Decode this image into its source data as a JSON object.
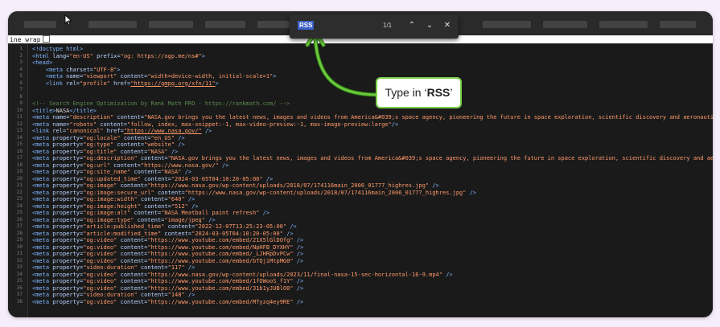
{
  "options": {
    "line_wrap_label": "ine wrap"
  },
  "find": {
    "query": "RSS",
    "count": "1/1",
    "prev_icon": "chevron-up-icon",
    "next_icon": "chevron-down-icon",
    "close_icon": "close-icon"
  },
  "callout": {
    "prefix": "Type in ",
    "quote_open": "‘",
    "term": "RSS",
    "quote_close": "’"
  },
  "colors": {
    "tag": "#7fb7ff",
    "value": "#ff9a6a",
    "comment": "#5e8a4f",
    "callout_border": "#7bd14a"
  },
  "lines": [
    {
      "n": "1",
      "parts": [
        [
          "tag",
          "<!doctype html>"
        ]
      ]
    },
    {
      "n": "2",
      "parts": [
        [
          "tag",
          "<html "
        ],
        [
          "attr",
          "lang="
        ],
        [
          "val",
          "\"en-US\""
        ],
        [
          "attr",
          " prefix="
        ],
        [
          "val",
          "\"og: https://ogp.me/ns#\""
        ],
        [
          "tag",
          ">"
        ]
      ]
    },
    {
      "n": "3",
      "parts": [
        [
          "tag",
          "<head>"
        ]
      ]
    },
    {
      "n": "4",
      "parts": [
        [
          "plain",
          "    "
        ],
        [
          "tag",
          "<meta "
        ],
        [
          "attr",
          "charset="
        ],
        [
          "val",
          "\"UTF-8\""
        ],
        [
          "tag",
          ">"
        ]
      ]
    },
    {
      "n": "5",
      "parts": [
        [
          "plain",
          "    "
        ],
        [
          "tag",
          "<meta "
        ],
        [
          "attr",
          "name="
        ],
        [
          "val",
          "\"viewport\""
        ],
        [
          "attr",
          " content="
        ],
        [
          "val",
          "\"width=device-width, initial-scale=1\""
        ],
        [
          "tag",
          ">"
        ]
      ]
    },
    {
      "n": "6",
      "parts": [
        [
          "plain",
          "    "
        ],
        [
          "tag",
          "<link "
        ],
        [
          "attr",
          "rel="
        ],
        [
          "val",
          "\"profile\""
        ],
        [
          "attr",
          " href="
        ],
        [
          "link",
          "\"https://gmpg.org/xfn/11\""
        ],
        [
          "tag",
          ">"
        ]
      ]
    },
    {
      "n": "7",
      "parts": []
    },
    {
      "n": "8",
      "parts": []
    },
    {
      "n": "9",
      "parts": [
        [
          "comment",
          "<!-- Search Engine Optimization by Rank Math PRO - https://rankmath.com/ -->"
        ]
      ]
    },
    {
      "n": "10",
      "parts": [
        [
          "tag",
          "<title>"
        ],
        [
          "plain",
          "NASA"
        ],
        [
          "tag",
          "</title>"
        ]
      ]
    },
    {
      "n": "11",
      "parts": [
        [
          "tag",
          "<meta "
        ],
        [
          "attr",
          "name="
        ],
        [
          "val",
          "\"description\""
        ],
        [
          "attr",
          " content="
        ],
        [
          "val",
          "\"NASA.gov brings you the latest news, images and videos from America&#039;s space agency, pioneering the future in space exploration, scientific discovery and aeronautics research.\""
        ]
      ]
    },
    {
      "n": "12",
      "parts": [
        [
          "tag",
          "<meta "
        ],
        [
          "attr",
          "name="
        ],
        [
          "val",
          "\"robots\""
        ],
        [
          "attr",
          " content="
        ],
        [
          "val",
          "\"follow, index, max-snippet:-1, max-video-preview:-1, max-image-preview:large\""
        ],
        [
          "tag",
          "/>"
        ]
      ]
    },
    {
      "n": "13",
      "parts": [
        [
          "tag",
          "<link "
        ],
        [
          "attr",
          "rel="
        ],
        [
          "val",
          "\"canonical\""
        ],
        [
          "attr",
          " href="
        ],
        [
          "link",
          "\"https://www.nasa.gov/\""
        ],
        [
          "tag",
          " />"
        ]
      ]
    },
    {
      "n": "14",
      "parts": [
        [
          "tag",
          "<meta "
        ],
        [
          "attr",
          "property="
        ],
        [
          "val",
          "\"og:locale\""
        ],
        [
          "attr",
          " content="
        ],
        [
          "val",
          "\"en_US\""
        ],
        [
          "tag",
          " />"
        ]
      ]
    },
    {
      "n": "15",
      "parts": [
        [
          "tag",
          "<meta "
        ],
        [
          "attr",
          "property="
        ],
        [
          "val",
          "\"og:type\""
        ],
        [
          "attr",
          " content="
        ],
        [
          "val",
          "\"website\""
        ],
        [
          "tag",
          " />"
        ]
      ]
    },
    {
      "n": "16",
      "parts": [
        [
          "tag",
          "<meta "
        ],
        [
          "attr",
          "property="
        ],
        [
          "val",
          "\"og:title\""
        ],
        [
          "attr",
          " content="
        ],
        [
          "val",
          "\"NASA\""
        ],
        [
          "tag",
          " />"
        ]
      ]
    },
    {
      "n": "17",
      "parts": [
        [
          "tag",
          "<meta "
        ],
        [
          "attr",
          "property="
        ],
        [
          "val",
          "\"og:description\""
        ],
        [
          "attr",
          " content="
        ],
        [
          "val",
          "\"NASA.gov brings you the latest news, images and videos from America&#039;s space agency, pioneering the future in space exploration, scientific discovery and aeronautics research.\""
        ]
      ]
    },
    {
      "n": "18",
      "parts": [
        [
          "tag",
          "<meta "
        ],
        [
          "attr",
          "property="
        ],
        [
          "val",
          "\"og:url\""
        ],
        [
          "attr",
          " content="
        ],
        [
          "val",
          "\"https://www.nasa.gov/\""
        ],
        [
          "tag",
          " />"
        ]
      ]
    },
    {
      "n": "19",
      "parts": [
        [
          "tag",
          "<meta "
        ],
        [
          "attr",
          "property="
        ],
        [
          "val",
          "\"og:site_name\""
        ],
        [
          "attr",
          " content="
        ],
        [
          "val",
          "\"NASA\""
        ],
        [
          "tag",
          " />"
        ]
      ]
    },
    {
      "n": "20",
      "parts": [
        [
          "tag",
          "<meta "
        ],
        [
          "attr",
          "property="
        ],
        [
          "val",
          "\"og:updated_time\""
        ],
        [
          "attr",
          " content="
        ],
        [
          "val",
          "\"2024-03-05T04:10:20-05:00\""
        ],
        [
          "tag",
          " />"
        ]
      ]
    },
    {
      "n": "21",
      "parts": [
        [
          "tag",
          "<meta "
        ],
        [
          "attr",
          "property="
        ],
        [
          "val",
          "\"og:image\""
        ],
        [
          "attr",
          " content="
        ],
        [
          "val",
          "\"https://www.nasa.gov/wp-content/uploads/2018/07/174116main_2006_01777_highres.jpg\""
        ],
        [
          "tag",
          " />"
        ]
      ]
    },
    {
      "n": "22",
      "parts": [
        [
          "tag",
          "<meta "
        ],
        [
          "attr",
          "property="
        ],
        [
          "val",
          "\"og:image:secure_url\""
        ],
        [
          "attr",
          " content="
        ],
        [
          "val",
          "\"https://www.nasa.gov/wp-content/uploads/2018/07/174116main_2006_01777_highres.jpg\""
        ],
        [
          "tag",
          " />"
        ]
      ]
    },
    {
      "n": "23",
      "parts": [
        [
          "tag",
          "<meta "
        ],
        [
          "attr",
          "property="
        ],
        [
          "val",
          "\"og:image:width\""
        ],
        [
          "attr",
          " content="
        ],
        [
          "val",
          "\"640\""
        ],
        [
          "tag",
          " />"
        ]
      ]
    },
    {
      "n": "24",
      "parts": [
        [
          "tag",
          "<meta "
        ],
        [
          "attr",
          "property="
        ],
        [
          "val",
          "\"og:image:height\""
        ],
        [
          "attr",
          " content="
        ],
        [
          "val",
          "\"512\""
        ],
        [
          "tag",
          " />"
        ]
      ]
    },
    {
      "n": "25",
      "parts": [
        [
          "tag",
          "<meta "
        ],
        [
          "attr",
          "property="
        ],
        [
          "val",
          "\"og:image:alt\""
        ],
        [
          "attr",
          " content="
        ],
        [
          "val",
          "\"NASA Meatball paint refresh\""
        ],
        [
          "tag",
          " />"
        ]
      ]
    },
    {
      "n": "26",
      "parts": [
        [
          "tag",
          "<meta "
        ],
        [
          "attr",
          "property="
        ],
        [
          "val",
          "\"og:image:type\""
        ],
        [
          "attr",
          " content="
        ],
        [
          "val",
          "\"image/jpeg\""
        ],
        [
          "tag",
          " />"
        ]
      ]
    },
    {
      "n": "27",
      "parts": [
        [
          "tag",
          "<meta "
        ],
        [
          "attr",
          "property="
        ],
        [
          "val",
          "\"article:published_time\""
        ],
        [
          "attr",
          " content="
        ],
        [
          "val",
          "\"2022-12-07T13:25:23-05:00\""
        ],
        [
          "tag",
          " />"
        ]
      ]
    },
    {
      "n": "28",
      "parts": [
        [
          "tag",
          "<meta "
        ],
        [
          "attr",
          "property="
        ],
        [
          "val",
          "\"article:modified_time\""
        ],
        [
          "attr",
          " content="
        ],
        [
          "val",
          "\"2024-03-05T04:10:20-05:00\""
        ],
        [
          "tag",
          " />"
        ]
      ]
    },
    {
      "n": "29",
      "parts": [
        [
          "tag",
          "<meta "
        ],
        [
          "attr",
          "property="
        ],
        [
          "val",
          "\"og:video\""
        ],
        [
          "attr",
          " content="
        ],
        [
          "val",
          "\"https://www.youtube.com/embed/21X5lGlDOfg\""
        ],
        [
          "tag",
          " />"
        ]
      ]
    },
    {
      "n": "30",
      "parts": [
        [
          "tag",
          "<meta "
        ],
        [
          "attr",
          "property="
        ],
        [
          "val",
          "\"og:video\""
        ],
        [
          "attr",
          " content="
        ],
        [
          "val",
          "\"https://www.youtube.com/embed/NpHFB_DYXHY\""
        ],
        [
          "tag",
          " />"
        ]
      ]
    },
    {
      "n": "31",
      "parts": [
        [
          "tag",
          "<meta "
        ],
        [
          "attr",
          "property="
        ],
        [
          "val",
          "\"og:video\""
        ],
        [
          "attr",
          " content="
        ],
        [
          "val",
          "\"https://www.youtube.com/embed/_LJHRpDvPCw\""
        ],
        [
          "tag",
          " />"
        ]
      ]
    },
    {
      "n": "32",
      "parts": [
        [
          "tag",
          "<meta "
        ],
        [
          "attr",
          "property="
        ],
        [
          "val",
          "\"og:video\""
        ],
        [
          "attr",
          " content="
        ],
        [
          "val",
          "\"https://www.youtube.com/embed/bTQjiMtpMG0\""
        ],
        [
          "tag",
          " />"
        ]
      ]
    },
    {
      "n": "33",
      "parts": [
        [
          "tag",
          "<meta "
        ],
        [
          "attr",
          "property="
        ],
        [
          "val",
          "\"video:duration\""
        ],
        [
          "attr",
          " content="
        ],
        [
          "val",
          "\"117\""
        ],
        [
          "tag",
          " />"
        ]
      ]
    },
    {
      "n": "34",
      "parts": [
        [
          "tag",
          "<meta "
        ],
        [
          "attr",
          "property="
        ],
        [
          "val",
          "\"og:video\""
        ],
        [
          "attr",
          " content="
        ],
        [
          "val",
          "\"https://www.nasa.gov/wp-content/uploads/2023/11/final-nasa-15-sec-horizontal-16-9.mp4\""
        ],
        [
          "tag",
          " />"
        ]
      ]
    },
    {
      "n": "35",
      "parts": [
        [
          "tag",
          "<meta "
        ],
        [
          "attr",
          "property="
        ],
        [
          "val",
          "\"og:video\""
        ],
        [
          "attr",
          " content="
        ],
        [
          "val",
          "\"https://www.youtube.com/embed/1fOWooS_f1Y\""
        ],
        [
          "tag",
          " />"
        ]
      ]
    },
    {
      "n": "36",
      "parts": [
        [
          "tag",
          "<meta "
        ],
        [
          "attr",
          "property="
        ],
        [
          "val",
          "\"og:video\""
        ],
        [
          "attr",
          " content="
        ],
        [
          "val",
          "\"https://www.youtube.com/embed/31b1yJUBlO0\""
        ],
        [
          "tag",
          " />"
        ]
      ]
    },
    {
      "n": "37",
      "parts": [
        [
          "tag",
          "<meta "
        ],
        [
          "attr",
          "property="
        ],
        [
          "val",
          "\"video:duration\""
        ],
        [
          "attr",
          " content="
        ],
        [
          "val",
          "\"148\""
        ],
        [
          "tag",
          " />"
        ]
      ]
    },
    {
      "n": "38",
      "parts": [
        [
          "tag",
          "<meta "
        ],
        [
          "attr",
          "property="
        ],
        [
          "val",
          "\"og:video\""
        ],
        [
          "attr",
          " content="
        ],
        [
          "val",
          "\"https://www.youtube.com/embed/MTyzq4ey9RE\""
        ],
        [
          "tag",
          " />"
        ]
      ]
    }
  ]
}
